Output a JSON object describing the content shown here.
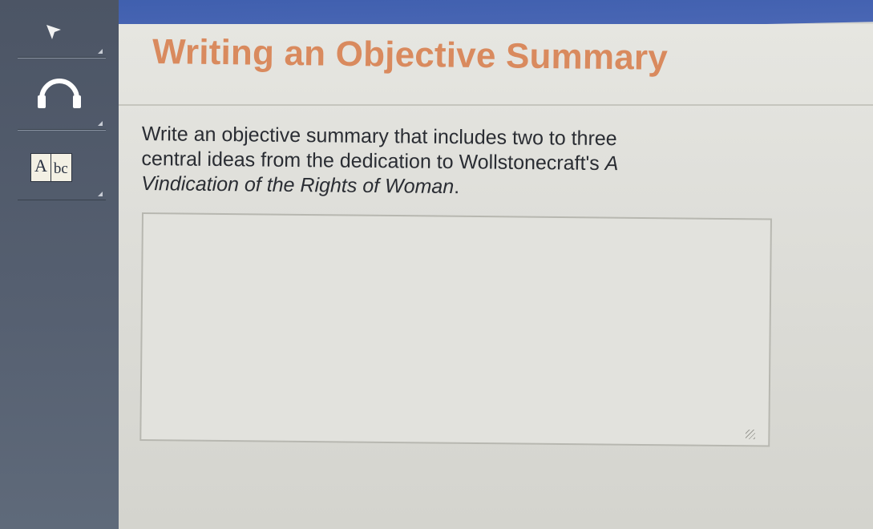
{
  "page": {
    "title": "Writing an Objective Summary"
  },
  "sidebar": {
    "items": [
      {
        "name": "pointer-tool",
        "icon": "cursor-icon"
      },
      {
        "name": "audio",
        "icon": "headphones-icon"
      },
      {
        "name": "dictionary",
        "icon": "dictionary-icon",
        "label_a": "A",
        "label_bc": "bc"
      }
    ]
  },
  "prompt": {
    "line1": "Write an objective summary that includes two to three",
    "line2_prefix": "central ideas from the dedication to Wollstonecraft's ",
    "line2_italic": "A",
    "line3_italic": "Vindication of the Rights of Woman",
    "line3_suffix": "."
  },
  "answer": {
    "value": "",
    "placeholder": ""
  },
  "colors": {
    "title": "#d98a5e",
    "sidebar": "#4c5565",
    "top_bar": "#3f5fae"
  }
}
